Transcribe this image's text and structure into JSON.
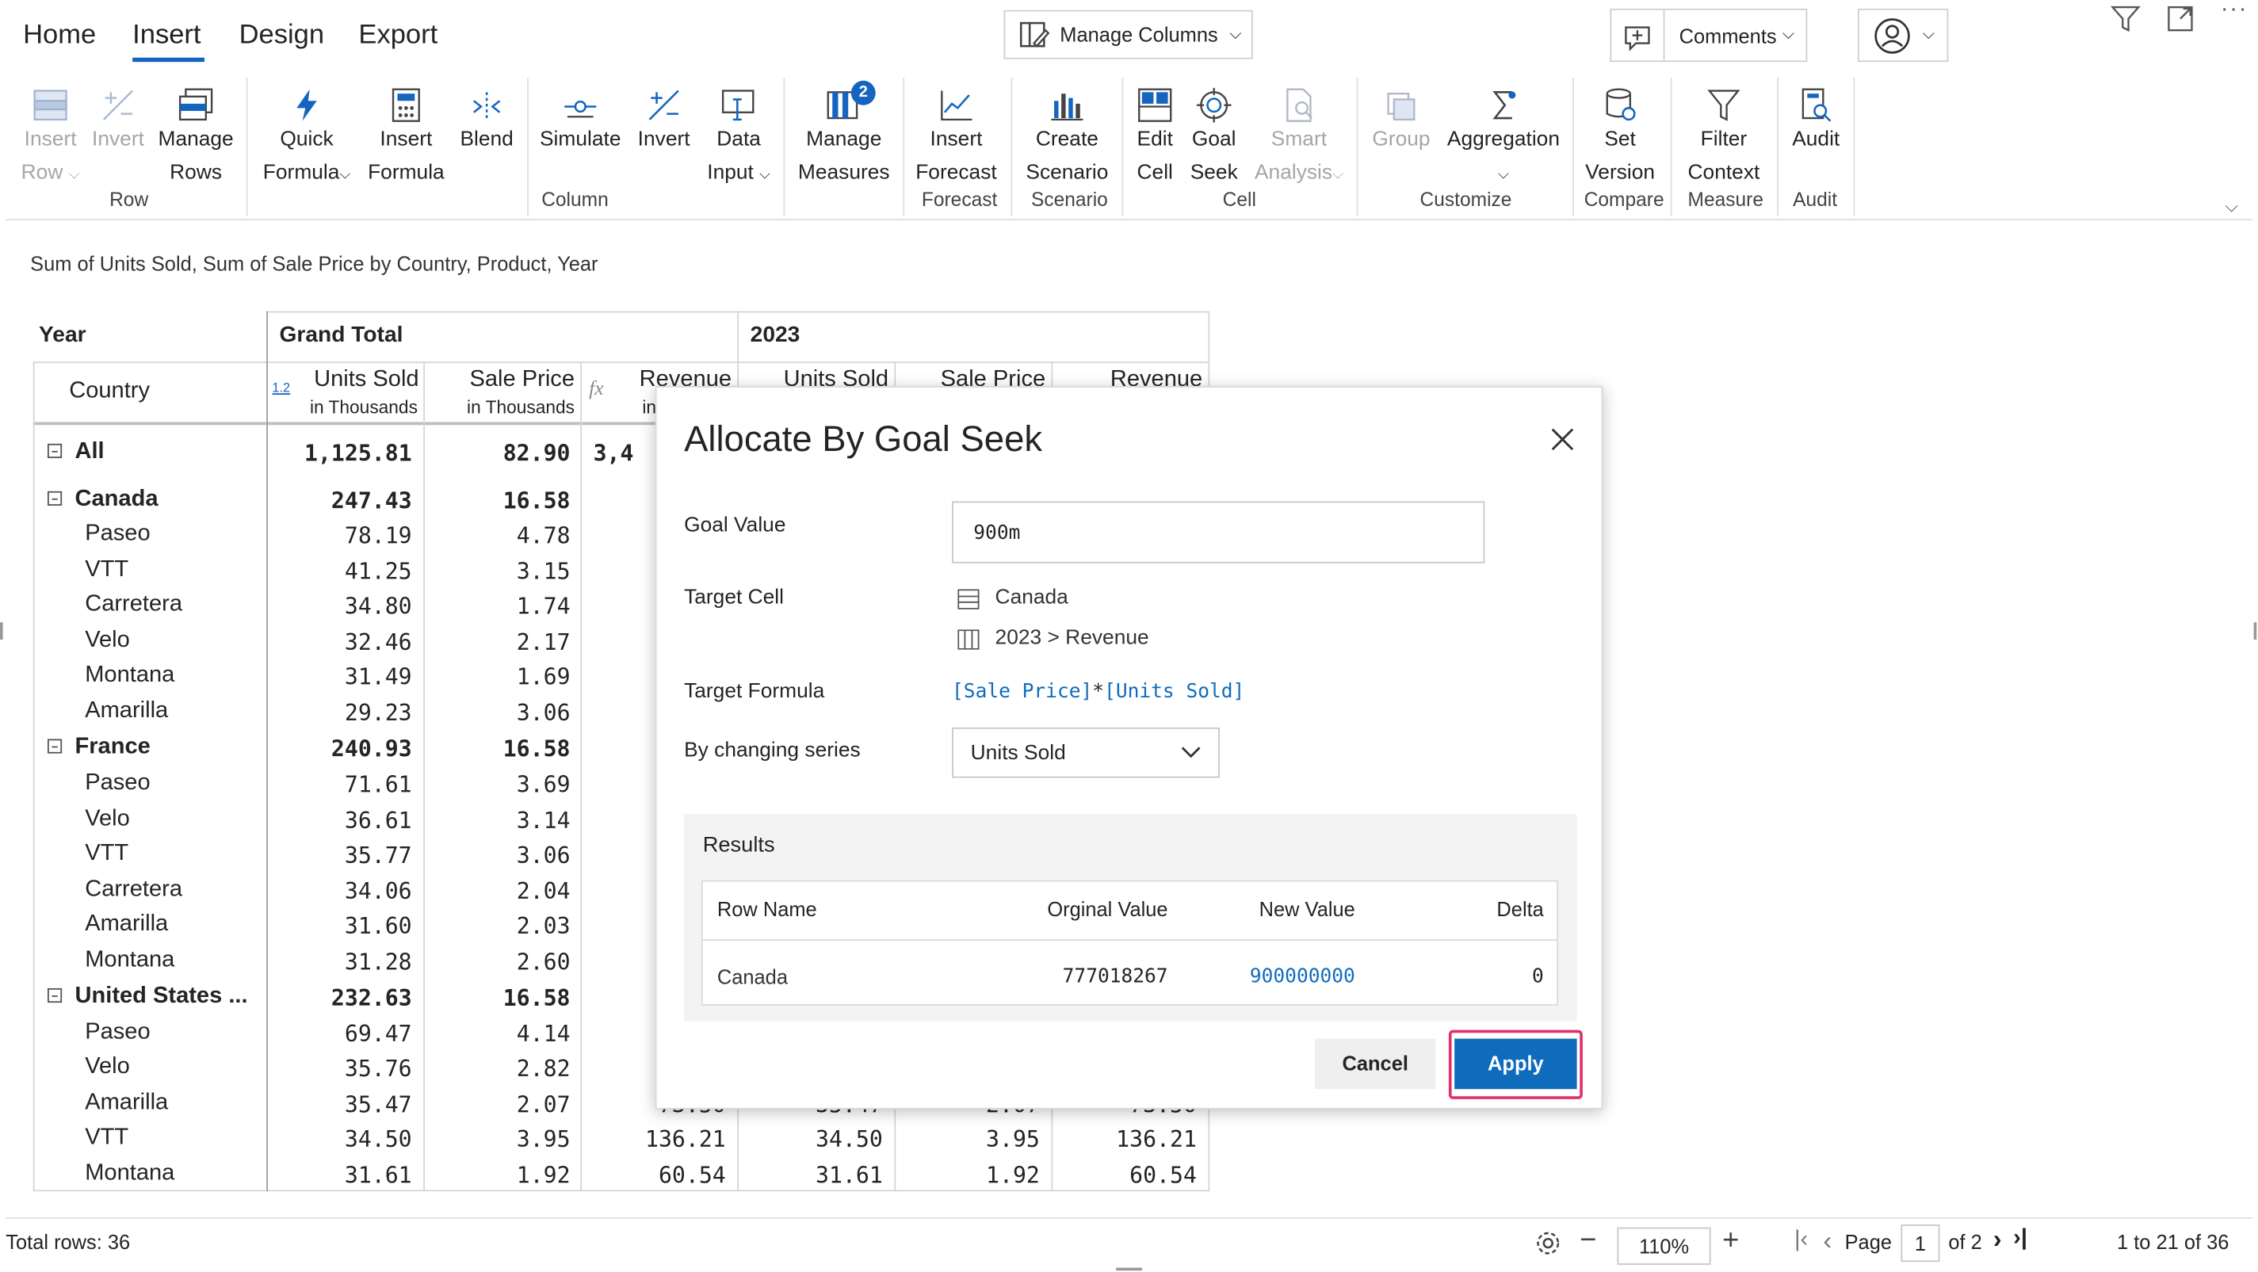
{
  "tabs": [
    "Home",
    "Insert",
    "Design",
    "Export"
  ],
  "active_tab": "Insert",
  "top": {
    "manage_columns": "Manage Columns",
    "comments": "Comments"
  },
  "ribbon": {
    "row": {
      "insert": "Insert",
      "insert2": "Row",
      "invert": "Invert",
      "manage": "Manage",
      "manage2": "Rows",
      "label": "Row"
    },
    "column": {
      "quick": "Quick",
      "quick2": "Formula",
      "insert": "Insert",
      "insert2": "Formula",
      "blend": "Blend",
      "simulate": "Simulate",
      "invert": "Invert",
      "data": "Data",
      "data2": "Input",
      "manage": "Manage",
      "manage2": "Measures",
      "badge": "2",
      "label": "Column"
    },
    "forecast": {
      "insert": "Insert",
      "insert2": "Forecast",
      "label": "Forecast"
    },
    "scenario": {
      "create": "Create",
      "create2": "Scenario",
      "label": "Scenario"
    },
    "cell": {
      "edit": "Edit",
      "edit2": "Cell",
      "goal": "Goal",
      "goal2": "Seek",
      "smart": "Smart",
      "smart2": "Analysis",
      "label": "Cell"
    },
    "customize": {
      "group": "Group",
      "aggregation": "Aggregation",
      "label": "Customize"
    },
    "compare": {
      "set": "Set",
      "set2": "Version",
      "label": "Compare"
    },
    "measure": {
      "filter": "Filter",
      "filter2": "Context",
      "label": "Measure"
    },
    "audit": {
      "audit": "Audit",
      "label": "Audit"
    }
  },
  "report": {
    "subtitle": "Sum of Units Sold, Sum of Sale Price by Country, Product, Year",
    "year_label": "Year",
    "country_label": "Country",
    "grand_total": "Grand Total",
    "year_2023": "2023",
    "col_units": "Units Sold",
    "col_units_sub": "in Thousands",
    "col_price": "Sale Price",
    "col_price_sub": "in Thousands",
    "col_revenue": "Revenue",
    "col_revenue_sub": "in",
    "col_units_2023": "Units Sold",
    "col_price_2023": "Sale Price",
    "col_revenue_2023": "Revenue",
    "badge_12": "1.2",
    "fx": "fx",
    "all_partial": "3,4",
    "rows": [
      {
        "name": "All",
        "units": "1,125.81",
        "price": "82.90",
        "bold": true,
        "expander": true,
        "indent": 0
      },
      {
        "name": "Canada",
        "units": "247.43",
        "price": "16.58",
        "bold": true,
        "expander": true,
        "indent": 0
      },
      {
        "name": "Paseo",
        "units": "78.19",
        "price": "4.78",
        "indent": 1
      },
      {
        "name": "VTT",
        "units": "41.25",
        "price": "3.15",
        "indent": 1
      },
      {
        "name": "Carretera",
        "units": "34.80",
        "price": "1.74",
        "indent": 1
      },
      {
        "name": "Velo",
        "units": "32.46",
        "price": "2.17",
        "indent": 1
      },
      {
        "name": "Montana",
        "units": "31.49",
        "price": "1.69",
        "indent": 1
      },
      {
        "name": "Amarilla",
        "units": "29.23",
        "price": "3.06",
        "indent": 1
      },
      {
        "name": "France",
        "units": "240.93",
        "price": "16.58",
        "bold": true,
        "expander": true,
        "indent": 0
      },
      {
        "name": "Paseo",
        "units": "71.61",
        "price": "3.69",
        "indent": 1
      },
      {
        "name": "Velo",
        "units": "36.61",
        "price": "3.14",
        "indent": 1
      },
      {
        "name": "VTT",
        "units": "35.77",
        "price": "3.06",
        "indent": 1
      },
      {
        "name": "Carretera",
        "units": "34.06",
        "price": "2.04",
        "indent": 1
      },
      {
        "name": "Amarilla",
        "units": "31.60",
        "price": "2.03",
        "indent": 1
      },
      {
        "name": "Montana",
        "units": "31.28",
        "price": "2.60",
        "indent": 1
      },
      {
        "name": "United States ...",
        "units": "232.63",
        "price": "16.58",
        "bold": true,
        "expander": true,
        "indent": 0
      },
      {
        "name": "Paseo",
        "units": "69.47",
        "price": "4.14",
        "indent": 1
      },
      {
        "name": "Velo",
        "units": "35.76",
        "price": "2.82",
        "indent": 1
      },
      {
        "name": "Amarilla",
        "units": "35.47",
        "price": "2.07",
        "indent": 1,
        "revenue": "73.50",
        "units_2023": "35.47",
        "price_2023": "2.07",
        "revenue_2023": "73.50"
      },
      {
        "name": "VTT",
        "units": "34.50",
        "price": "3.95",
        "indent": 1,
        "revenue": "136.21",
        "units_2023": "34.50",
        "price_2023": "3.95",
        "revenue_2023": "136.21"
      },
      {
        "name": "Montana",
        "units": "31.61",
        "price": "1.92",
        "indent": 1,
        "revenue": "60.54",
        "units_2023": "31.61",
        "price_2023": "1.92",
        "revenue_2023": "60.54"
      }
    ]
  },
  "dialog": {
    "title": "Allocate By Goal Seek",
    "goal_label": "Goal Value",
    "goal_value": "900m",
    "target_cell_label": "Target Cell",
    "target_row": "Canada",
    "target_col": "2023 > Revenue",
    "target_formula_label": "Target Formula",
    "formula_a": "[Sale Price]",
    "formula_op": "*",
    "formula_b": "[Units Sold]",
    "changing_label": "By changing series",
    "changing_value": "Units Sold",
    "results_label": "Results",
    "results_headers": {
      "row_name": "Row Name",
      "orig": "Orginal Value",
      "new": "New Value",
      "delta": "Delta"
    },
    "results_row": {
      "row_name": "Canada",
      "orig": "777018267",
      "new": "900000000",
      "delta": "0"
    },
    "cancel": "Cancel",
    "apply": "Apply"
  },
  "status": {
    "total_rows": "Total rows: 36",
    "zoom": "110%",
    "page_label": "Page",
    "page_value": "1",
    "page_of": "of 2",
    "range": "1 to 21 of 36"
  },
  "colors": {
    "accent": "#0f6cbd",
    "apply_highlight": "#e0306b",
    "link": "#0f6cbd"
  }
}
